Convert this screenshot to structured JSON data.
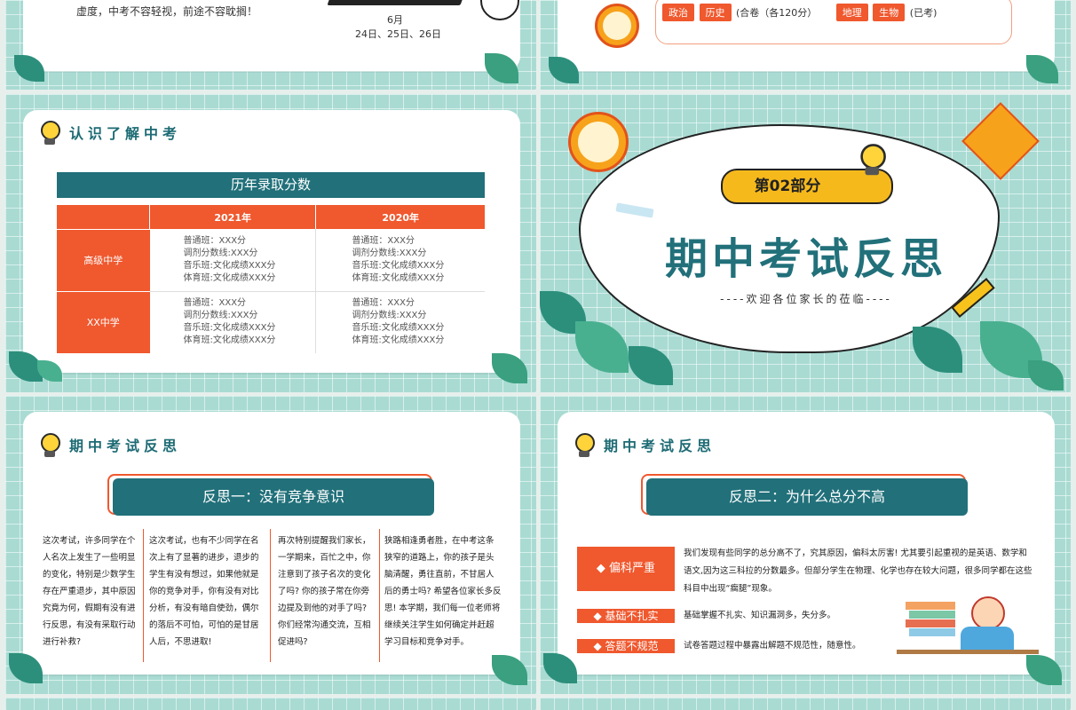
{
  "slide1": {
    "text": "虚度，中考不容轻视，前途不容耽搁！",
    "date_month": "6月",
    "date_days": "24日、25日、26日"
  },
  "slide2": {
    "tags_a": [
      "政治",
      "历史"
    ],
    "note_a": "(合卷（各120分）",
    "tags_b": [
      "地理",
      "生物"
    ],
    "note_b": "(已考)"
  },
  "slide3": {
    "section_title": "认识了解中考",
    "table_title": "历年录取分数",
    "columns": [
      "",
      "2021年",
      "2020年"
    ],
    "rows": [
      {
        "name": "高级中学",
        "y2021": [
          "普通班：XXX分",
          "调剂分数线:XXX分",
          "音乐班:文化成绩XXX分",
          "体育班:文化成绩XXX分"
        ],
        "y2020": [
          "普通班：XXX分",
          "调剂分数线:XXX分",
          "音乐班:文化成绩XXX分",
          "体育班:文化成绩XXX分"
        ]
      },
      {
        "name": "XX中学",
        "y2021": [
          "普通班：XXX分",
          "调剂分数线:XXX分",
          "音乐班:文化成绩XXX分",
          "体育班:文化成绩XXX分"
        ],
        "y2020": [
          "普通班：XXX分",
          "调剂分数线:XXX分",
          "音乐班:文化成绩XXX分",
          "体育班:文化成绩XXX分"
        ]
      }
    ]
  },
  "slide4": {
    "part_label": "第02部分",
    "main_title": "期中考试反思",
    "subtitle": "----欢迎各位家长的莅临----"
  },
  "slide5": {
    "section_title": "期中考试反思",
    "banner": "反思一：没有竞争意识",
    "paragraphs": [
      "这次考试，许多同学在个人名次上发生了一些明显的变化，特别是少数学生存在严重退步，其中原因究竟为何，假期有没有进行反思，有没有采取行动进行补救?",
      "这次考试，也有不少同学在名次上有了显著的进步，退步的学生有没有想过，如果他就是你的竞争对手，你有没有对比分析，有没有暗自使劲，偶尔的落后不可怕，可怕的是甘居人后，不思进取!",
      "再次特别提醒我们家长，一学期来，百忙之中，你注意到了孩子名次的变化了吗? 你的孩子常在你旁边提及到他的对手了吗? 你们经常沟通交流，互相促进吗?",
      "狭路相逢勇者胜，在中考这条狭窄的道路上，你的孩子是头脑清醒，勇往直前，不甘居人后的勇士吗? 希望各位家长多反思! 本学期，我们每一位老师将继续关注学生如何确定并赶超学习目标和竞争对手。"
    ]
  },
  "slide6": {
    "section_title": "期中考试反思",
    "banner": "反思二：为什么总分不高",
    "items": [
      {
        "label": "◆ 偏科严重",
        "text": "我们发现有些同学的总分高不了，究其原因，偏科太厉害! 尤其要引起重视的是英语、数学和语文,因为这三科拉的分数最多。但部分学生在物理、化学也存在较大问题，很多同学都在这些科目中出现“瘸腿”现象。"
      },
      {
        "label": "◆ 基础不扎实",
        "text": "基础掌握不扎实、知识漏洞多，失分多。"
      },
      {
        "label": "◆ 答题不规范",
        "text": "试卷答题过程中暴露出解题不规范性，随意性。"
      }
    ]
  },
  "colors": {
    "accent": "#f0582e",
    "teal": "#21707a",
    "grid": "#a9dbd3"
  },
  "icons": [
    "lightbulb-icon",
    "alarm-clock-icon",
    "kite-icon",
    "pencil-icon",
    "book-icon",
    "student-illustration"
  ]
}
